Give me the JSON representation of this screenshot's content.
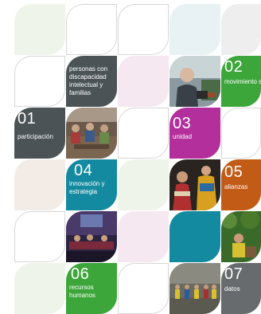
{
  "tiles": {
    "personas": {
      "text": "personas con discapacidad intelectual y familias"
    },
    "participacion": {
      "number": "01",
      "label": "participación"
    },
    "movimiento_social": {
      "number": "02",
      "label": "movimiento social"
    },
    "unidad": {
      "number": "03",
      "label": "unidad"
    },
    "innovacion": {
      "number": "04",
      "label": "innovación y estrategia"
    },
    "alianzas": {
      "number": "05",
      "label": "alianzas"
    },
    "recursos": {
      "number": "06",
      "label": "recursos humanos"
    },
    "datos": {
      "number": "07",
      "label": "datos"
    }
  },
  "photos": [
    {
      "icon": "speaker-photo",
      "description_visible": false
    },
    {
      "icon": "meeting-photo"
    },
    {
      "icon": "festival-photo"
    },
    {
      "icon": "conference-photo"
    },
    {
      "icon": "garden-photo"
    },
    {
      "icon": "event-photo"
    }
  ],
  "colors": {
    "green": "#3ca63a",
    "magenta": "#b32f9c",
    "teal": "#138aa0",
    "orange": "#c25b16",
    "dark_gray": "#4b5356",
    "gray": "#676b6d"
  }
}
